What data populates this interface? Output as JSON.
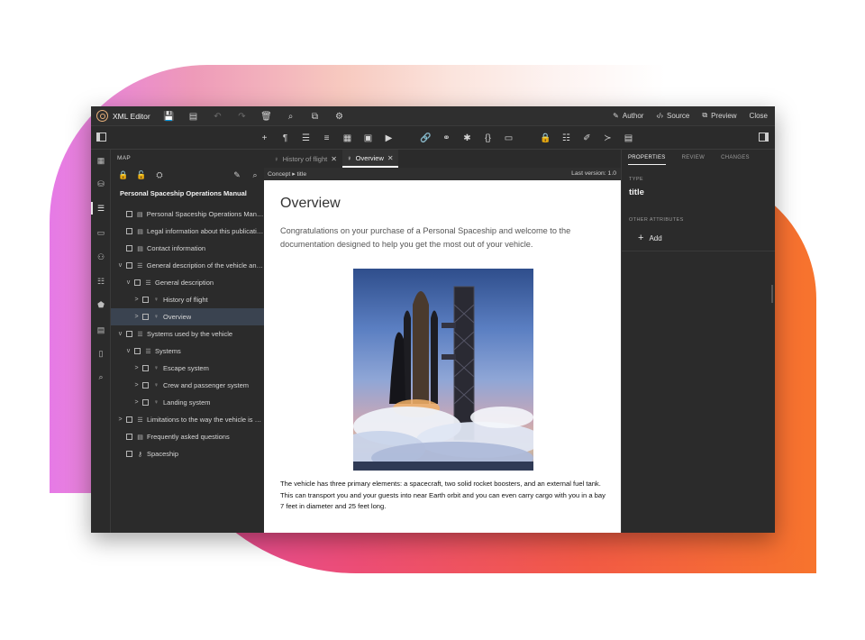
{
  "app": {
    "title": "XML Editor",
    "modes": [
      "Author",
      "Source",
      "Preview"
    ],
    "close_label": "Close",
    "accent_color": "#4e95e8"
  },
  "map": {
    "label": "MAP",
    "title": "Personal Spaceship Operations Manual",
    "items": [
      {
        "label": "Personal Spaceship Operations Manual",
        "chevron": "",
        "icon": "map-topic-icon"
      },
      {
        "label": "Legal information about this publication",
        "chevron": "",
        "icon": "map-topic-icon"
      },
      {
        "label": "Contact information",
        "chevron": "",
        "icon": "map-topic-icon"
      },
      {
        "label": "General description of the vehicle and...",
        "chevron": "v",
        "icon": "map-topic-icon"
      },
      {
        "label": "General description",
        "chevron": "v",
        "icon": "map-topic-icon"
      },
      {
        "label": "History of flight",
        "chevron": ">",
        "icon": "concept-icon"
      },
      {
        "label": "Overview",
        "chevron": ">",
        "icon": "concept-icon"
      },
      {
        "label": "Systems used by the vehicle",
        "chevron": "v",
        "icon": "map-topic-icon"
      },
      {
        "label": "Systems",
        "chevron": "v",
        "icon": "map-topic-icon"
      },
      {
        "label": "Escape system",
        "chevron": ">",
        "icon": "concept-icon"
      },
      {
        "label": "Crew and passenger system",
        "chevron": ">",
        "icon": "concept-icon"
      },
      {
        "label": "Landing system",
        "chevron": ">",
        "icon": "concept-icon"
      },
      {
        "label": "Limitations to the way the vehicle is o...",
        "chevron": ">",
        "icon": "map-topic-icon"
      },
      {
        "label": "Frequently asked questions",
        "chevron": "",
        "icon": "map-topic-icon"
      },
      {
        "label": "Spaceship",
        "chevron": "",
        "icon": "key-icon"
      }
    ],
    "selected_index": 6
  },
  "tabs": [
    {
      "label": "History of flight"
    },
    {
      "label": "Overview"
    }
  ],
  "breadcrumb": {
    "path": [
      "Concept",
      "title"
    ],
    "version": "Last version: 1.0"
  },
  "document": {
    "title": "Overview",
    "intro": "Congratulations on your purchase of a Personal Spaceship and welcome to the documentation designed to help you get the most out of your vehicle.",
    "body": "The vehicle has three primary elements: a spacecraft, two solid rocket boosters, and an external fuel tank. This can transport you and your guests into near Earth orbit and you can even carry cargo with you in a bay 7 feet in diameter and 25 feet long."
  },
  "properties": {
    "tabs": [
      "PROPERTIES",
      "REVIEW",
      "CHANGES"
    ],
    "type_label": "TYPE",
    "type_value": "title",
    "other_label": "OTHER ATTRIBUTES",
    "add_label": "Add"
  }
}
